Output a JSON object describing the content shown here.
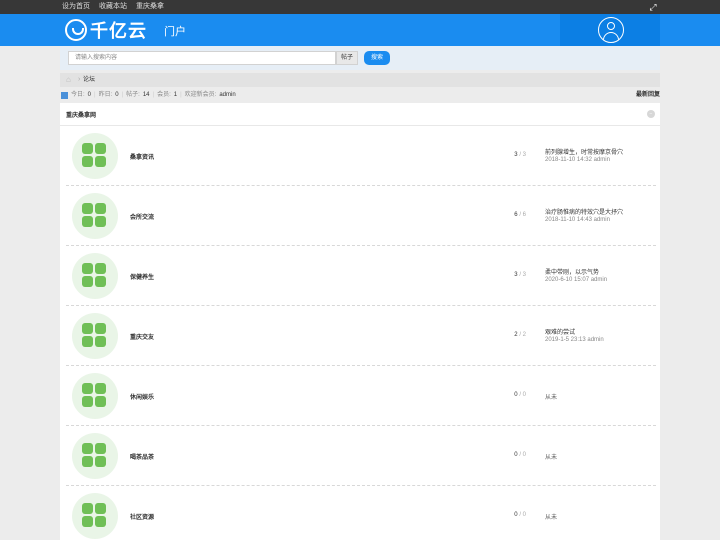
{
  "topbar": {
    "links": [
      "设为首页",
      "收藏本站",
      "重庆桑拿"
    ],
    "fullscreen_icon": "fullscreen-icon"
  },
  "header": {
    "logo_text": "千亿云",
    "nav_portal": "门户",
    "brand_color": "#1a8cf0"
  },
  "search": {
    "placeholder": "请输入搜索内容",
    "type": "帖子",
    "button": "搜索"
  },
  "breadcrumb": {
    "sep": "›",
    "current": "论坛"
  },
  "stats": {
    "today_label": "今日:",
    "today": "0",
    "yesterday_label": "昨日:",
    "yesterday": "0",
    "posts_label": "帖子:",
    "posts": "14",
    "members_label": "会员:",
    "members": "1",
    "welcome_label": "欢迎新会员:",
    "new_member": "admin",
    "latest_label": "最新回复"
  },
  "panel": {
    "title": "重庆桑拿网"
  },
  "forums": [
    {
      "name": "桑拿资讯",
      "threads": "3",
      "sep": "/",
      "posts": "3",
      "last_title": "前列腺增生，时常按摩京骨穴",
      "last_meta": "2018-11-10 14:32 admin"
    },
    {
      "name": "会所交流",
      "threads": "6",
      "sep": "/",
      "posts": "6",
      "last_title": "治疗肠惟病的特效穴是大抒穴",
      "last_meta": "2018-11-10 14:43 admin"
    },
    {
      "name": "保健养生",
      "threads": "3",
      "sep": "/",
      "posts": "3",
      "last_title": "柔中带刚，以示气势",
      "last_meta": "2020-6-10 15:07 admin"
    },
    {
      "name": "重庆交友",
      "threads": "2",
      "sep": "/",
      "posts": "2",
      "last_title": "艰难的尝试",
      "last_meta": "2019-1-5 23:13 admin"
    },
    {
      "name": "休闲娱乐",
      "threads": "0",
      "sep": "/",
      "posts": "0",
      "never": "从未"
    },
    {
      "name": "喝茶品茶",
      "threads": "0",
      "sep": "/",
      "posts": "0",
      "never": "从未"
    },
    {
      "name": "社区资源",
      "threads": "0",
      "sep": "/",
      "posts": "0",
      "never": "从未"
    }
  ]
}
